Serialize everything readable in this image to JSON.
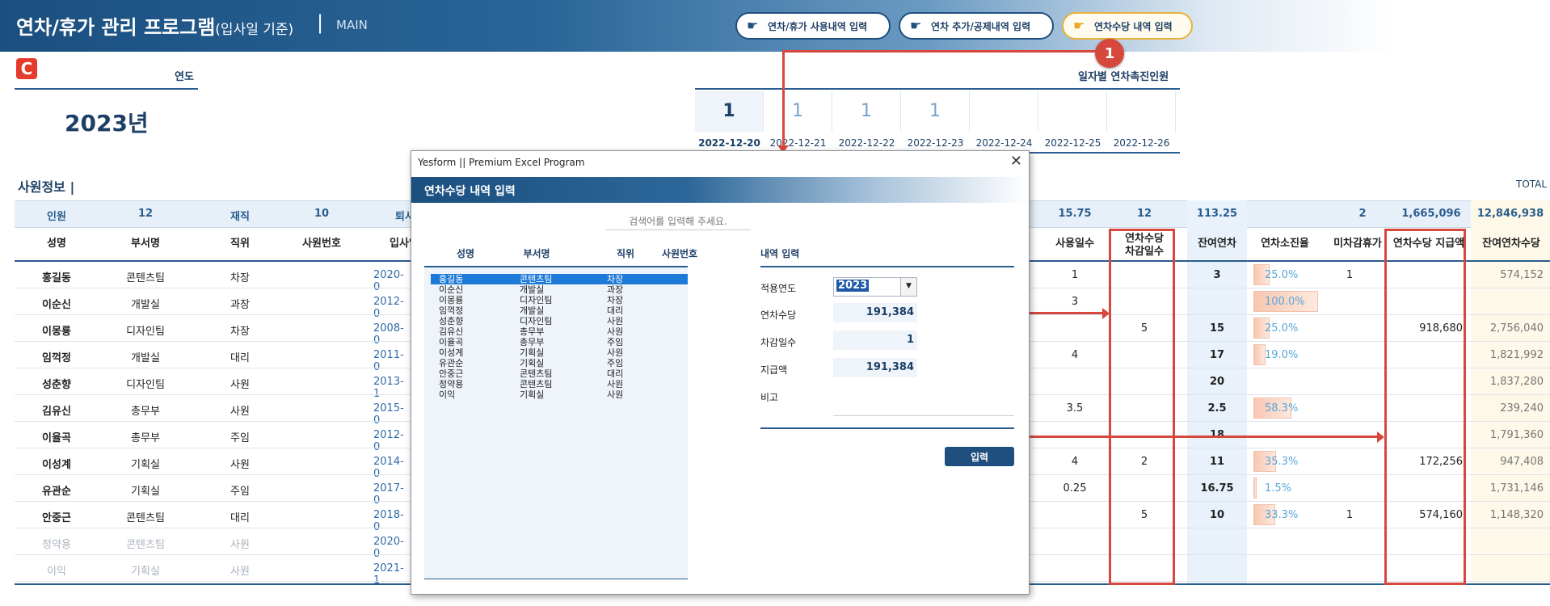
{
  "header": {
    "title_main": "연차/휴가 관리 프로그램",
    "title_sub": "(입사일 기준)",
    "separator": "|",
    "section": "MAIN",
    "buttons": [
      "연차/휴가 사용내역 입력",
      "연차 추가/공제내역 입력",
      "연차수당 내역 입력"
    ],
    "step_number": "1"
  },
  "logo": {
    "glyph": "C",
    "color": "#e43b2c"
  },
  "year": {
    "label": "연도",
    "value": "2023년"
  },
  "promotion": {
    "title": "일자별 연차촉진인원",
    "counts": [
      "1",
      "1",
      "1",
      "1",
      "",
      "",
      ""
    ],
    "dates": [
      "2022-12-20",
      "2022-12-21",
      "2022-12-22",
      "2022-12-23",
      "2022-12-24",
      "2022-12-25",
      "2022-12-26"
    ]
  },
  "employees": {
    "section_title": "사원정보 |",
    "total_label": "TOTAL",
    "summary": {
      "headcount_label": "인원",
      "headcount": "12",
      "active_label": "재직",
      "active": "10",
      "retired_label": "퇴사",
      "used_days": "15.75",
      "allowance_days": "12",
      "remaining": "113.25",
      "unused_vacation": "2",
      "allowance_total": "1,665,096",
      "remaining_allowance_total": "12,846,938"
    },
    "headers": {
      "name": "성명",
      "dept": "부서명",
      "position": "직위",
      "emp_no": "사원번호",
      "hire_date": "입사일",
      "used_days": "사용일수",
      "allowance_days_1": "연차수당",
      "allowance_days_2": "차감일수",
      "remaining": "잔여연차",
      "usage_rate": "연차소진율",
      "unused": "미차감휴가",
      "allowance_amount": "연차수당 지급액",
      "remaining_allowance": "잔여연차수당"
    },
    "rows": [
      {
        "name": "홍길동",
        "dept": "콘텐츠팀",
        "position": "차장",
        "hire": "2020-0",
        "used": "1",
        "allow_days": "",
        "remain": "3",
        "rate": "25.0%",
        "rate_val": 0.25,
        "unused": "1",
        "allow_amt": "",
        "remain_amt": "574,152"
      },
      {
        "name": "이순신",
        "dept": "개발실",
        "position": "과장",
        "hire": "2012-0",
        "used": "3",
        "allow_days": "",
        "remain": "",
        "rate": "100.0%",
        "rate_val": 1.0,
        "unused": "",
        "allow_amt": "",
        "remain_amt": ""
      },
      {
        "name": "이몽룡",
        "dept": "디자인팀",
        "position": "차장",
        "hire": "2008-0",
        "used": "",
        "allow_days": "5",
        "remain": "15",
        "rate": "25.0%",
        "rate_val": 0.25,
        "unused": "",
        "allow_amt": "918,680",
        "remain_amt": "2,756,040"
      },
      {
        "name": "임꺽정",
        "dept": "개발실",
        "position": "대리",
        "hire": "2011-0",
        "used": "4",
        "allow_days": "",
        "remain": "17",
        "rate": "19.0%",
        "rate_val": 0.19,
        "unused": "",
        "allow_amt": "",
        "remain_amt": "1,821,992"
      },
      {
        "name": "성춘향",
        "dept": "디자인팀",
        "position": "사원",
        "hire": "2013-1",
        "used": "",
        "allow_days": "",
        "remain": "20",
        "rate": "",
        "rate_val": 0,
        "unused": "",
        "allow_amt": "",
        "remain_amt": "1,837,280"
      },
      {
        "name": "김유신",
        "dept": "총무부",
        "position": "사원",
        "hire": "2015-0",
        "used": "3.5",
        "allow_days": "",
        "remain": "2.5",
        "rate": "58.3%",
        "rate_val": 0.583,
        "unused": "",
        "allow_amt": "",
        "remain_amt": "239,240"
      },
      {
        "name": "이율곡",
        "dept": "총무부",
        "position": "주임",
        "hire": "2012-0",
        "used": "",
        "allow_days": "",
        "remain": "18",
        "rate": "",
        "rate_val": 0,
        "unused": "",
        "allow_amt": "",
        "remain_amt": "1,791,360"
      },
      {
        "name": "이성계",
        "dept": "기획실",
        "position": "사원",
        "hire": "2014-0",
        "used": "4",
        "allow_days": "2",
        "remain": "11",
        "rate": "35.3%",
        "rate_val": 0.353,
        "unused": "",
        "allow_amt": "172,256",
        "remain_amt": "947,408"
      },
      {
        "name": "유관순",
        "dept": "기획실",
        "position": "주임",
        "hire": "2017-0",
        "used": "0.25",
        "allow_days": "",
        "remain": "16.75",
        "rate": "1.5%",
        "rate_val": 0.015,
        "unused": "",
        "allow_amt": "",
        "remain_amt": "1,731,146"
      },
      {
        "name": "안중근",
        "dept": "콘텐츠팀",
        "position": "대리",
        "hire": "2018-0",
        "used": "",
        "allow_days": "5",
        "remain": "10",
        "rate": "33.3%",
        "rate_val": 0.333,
        "unused": "1",
        "allow_amt": "574,160",
        "remain_amt": "1,148,320"
      },
      {
        "name": "정약용",
        "dept": "콘텐츠팀",
        "position": "사원",
        "hire": "2020-0",
        "used": "",
        "allow_days": "",
        "remain": "",
        "rate": "",
        "rate_val": 0,
        "unused": "",
        "allow_amt": "",
        "remain_amt": "",
        "muted": true
      },
      {
        "name": "이익",
        "dept": "기획실",
        "position": "사원",
        "hire": "2021-1",
        "used": "",
        "allow_days": "",
        "remain": "",
        "rate": "",
        "rate_val": 0,
        "unused": "",
        "allow_amt": "",
        "remain_amt": "",
        "muted": true
      }
    ]
  },
  "dialog": {
    "window_title": "Yesform  ||  Premium Excel Program",
    "close_glyph": "✕",
    "banner": "연차수당 내역 입력",
    "search_placeholder": "검색어를 입력해 주세요.",
    "list_headers": [
      "성명",
      "부서명",
      "직위",
      "사원번호"
    ],
    "list_rows": [
      [
        "홍길동",
        "콘텐츠팀",
        "차장"
      ],
      [
        "이순신",
        "개발실",
        "과장"
      ],
      [
        "이몽룡",
        "디자인팀",
        "차장"
      ],
      [
        "임꺽정",
        "개발실",
        "대리"
      ],
      [
        "성춘향",
        "디자인팀",
        "사원"
      ],
      [
        "김유신",
        "총무부",
        "사원"
      ],
      [
        "이율곡",
        "총무부",
        "주임"
      ],
      [
        "이성계",
        "기획실",
        "사원"
      ],
      [
        "유관순",
        "기획실",
        "주임"
      ],
      [
        "안중근",
        "콘텐츠팀",
        "대리"
      ],
      [
        "정약용",
        "콘텐츠팀",
        "사원"
      ],
      [
        "이익",
        "기획실",
        "사원"
      ]
    ],
    "form": {
      "title": "내역 입력",
      "year_label": "적용연도",
      "year_value": "2023",
      "allowance_label": "연차수당",
      "allowance_value": "191,384",
      "days_label": "차감일수",
      "days_value": "1",
      "amount_label": "지급액",
      "amount_value": "191,384",
      "note_label": "비고",
      "submit_label": "입력"
    }
  },
  "colors": {
    "accent": "#1f4f7f",
    "highlight": "#d6473e",
    "selected": "#1e7ad9"
  }
}
